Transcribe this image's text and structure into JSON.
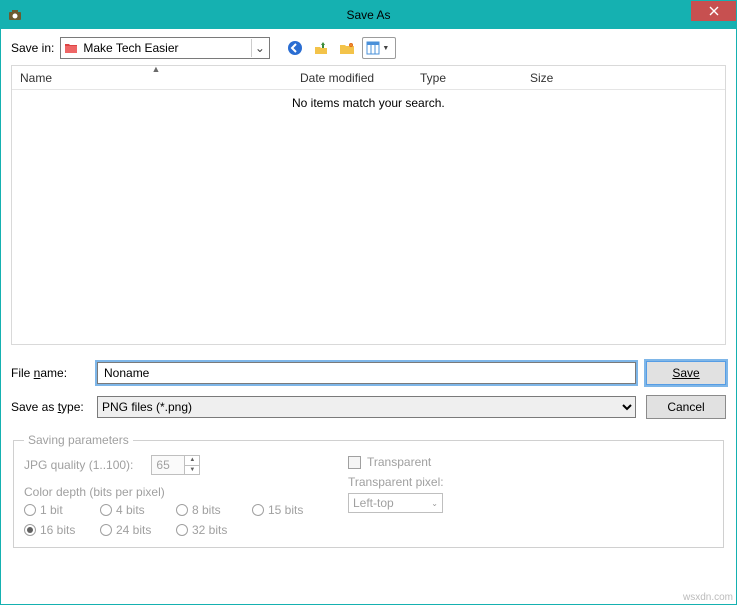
{
  "title": "Save As",
  "savein_label": "Save in:",
  "savein_folder": "Make Tech Easier",
  "columns": {
    "name": "Name",
    "date": "Date modified",
    "type": "Type",
    "size": "Size"
  },
  "empty_message": "No items match your search.",
  "filename_label": "File name:",
  "filename_value": "Noname",
  "savetype_label": "Save as type:",
  "savetype_value": "PNG files (*.png)",
  "save_btn": "Save",
  "cancel_btn": "Cancel",
  "params": {
    "legend": "Saving parameters",
    "jpg_label": "JPG quality (1..100):",
    "jpg_value": "65",
    "depth_label": "Color depth (bits per pixel)",
    "bits": {
      "b1": "1 bit",
      "b4": "4 bits",
      "b8": "8 bits",
      "b15": "15 bits",
      "b16": "16 bits",
      "b24": "24 bits",
      "b32": "32 bits"
    },
    "transparent": "Transparent",
    "tp_label": "Transparent pixel:",
    "tp_value": "Left-top"
  },
  "watermark": "wsxdn.com"
}
